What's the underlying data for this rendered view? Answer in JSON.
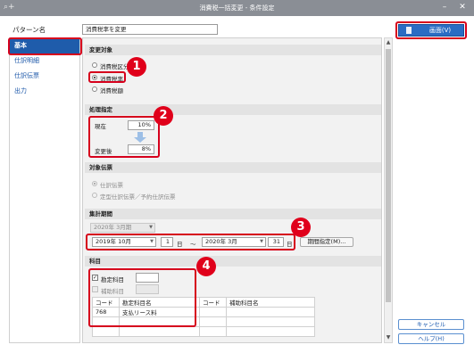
{
  "window": {
    "title": "消費税一括変更 - 条件設定"
  },
  "pattern": {
    "label": "パターン名",
    "value": "消費税率を変更"
  },
  "sidebar": {
    "items": [
      {
        "label": "基本"
      },
      {
        "label": "仕訳明細"
      },
      {
        "label": "仕訳伝票"
      },
      {
        "label": "出力"
      }
    ]
  },
  "sections": {
    "change_target": {
      "heading": "変更対象",
      "options": [
        {
          "label": "消費税区分",
          "selected": false
        },
        {
          "label": "消費税率",
          "selected": true
        },
        {
          "label": "消費税額",
          "selected": false
        }
      ]
    },
    "process": {
      "heading": "処理指定",
      "current_label": "現在",
      "current_value": "10%",
      "arrow": "down-arrow-icon",
      "after_label": "変更後",
      "after_value": "8%"
    },
    "target_slip": {
      "heading": "対象伝票",
      "options": [
        {
          "label": "仕訳伝票",
          "selected": true
        },
        {
          "label": "定型仕訳伝票／予約仕訳伝票",
          "selected": false
        }
      ]
    },
    "period": {
      "heading": "集計期間",
      "preset": "2020年  3月期",
      "from_month": "2019年 10月",
      "from_day": "1",
      "day_unit": "日",
      "tilde": "～",
      "to_month": "2020年  3月",
      "to_day": "31",
      "period_button": "期間指定(M)..."
    },
    "account": {
      "heading": "科目",
      "account_check_label": "勘定科目",
      "sub_check_label": "補助科目",
      "columns": [
        "コード",
        "勘定科目名",
        "コード",
        "補助科目名"
      ],
      "rows": [
        [
          "768",
          "支払リース料",
          "",
          ""
        ]
      ]
    }
  },
  "buttons": {
    "print": "画面(V)",
    "cancel": "キャンセル",
    "help": "ヘルプ(H)"
  },
  "callouts": [
    "1",
    "2",
    "3",
    "4"
  ],
  "colors": {
    "accent": "#1f5cab",
    "callout": "#e0001b"
  }
}
